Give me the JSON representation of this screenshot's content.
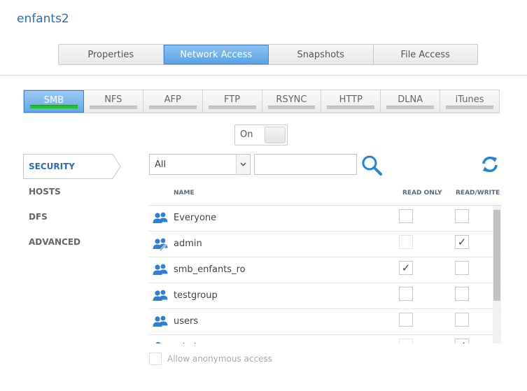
{
  "share": {
    "title": "enfants2"
  },
  "main_tabs": [
    {
      "label": "Properties",
      "active": false
    },
    {
      "label": "Network Access",
      "active": true
    },
    {
      "label": "Snapshots",
      "active": false
    },
    {
      "label": "File Access",
      "active": false
    }
  ],
  "protocol_tabs": [
    {
      "label": "SMB",
      "active": true
    },
    {
      "label": "NFS",
      "active": false
    },
    {
      "label": "AFP",
      "active": false
    },
    {
      "label": "FTP",
      "active": false
    },
    {
      "label": "RSYNC",
      "active": false
    },
    {
      "label": "HTTP",
      "active": false
    },
    {
      "label": "DLNA",
      "active": false
    },
    {
      "label": "iTunes",
      "active": false
    }
  ],
  "toggle": {
    "label": "On"
  },
  "side_nav": [
    {
      "label": "SECURITY",
      "active": true
    },
    {
      "label": "HOSTS",
      "active": false
    },
    {
      "label": "DFS",
      "active": false
    },
    {
      "label": "ADVANCED",
      "active": false
    }
  ],
  "filter": {
    "selected": "All",
    "search_value": ""
  },
  "table": {
    "headers": {
      "name": "NAME",
      "read_only": "READ ONLY",
      "read_write": "READ/WRITE"
    },
    "rows": [
      {
        "name": "Everyone",
        "icon": "group-icon",
        "read_only": false,
        "read_write": false,
        "ro_disabled": false
      },
      {
        "name": "admin",
        "icon": "admin-group-icon",
        "read_only": false,
        "read_write": true,
        "ro_disabled": true
      },
      {
        "name": "smb_enfants_ro",
        "icon": "group-icon",
        "read_only": true,
        "read_write": false,
        "ro_disabled": false
      },
      {
        "name": "testgroup",
        "icon": "group-icon",
        "read_only": false,
        "read_write": false,
        "ro_disabled": false
      },
      {
        "name": "users",
        "icon": "group-icon",
        "read_only": false,
        "read_write": false,
        "ro_disabled": false
      },
      {
        "name": "admin",
        "icon": "user-icon",
        "read_only": false,
        "read_write": true,
        "ro_disabled": true
      }
    ]
  },
  "anonymous": {
    "label": "Allow anonymous access",
    "checked": false
  },
  "colors": {
    "accent": "#2a6ebb",
    "active_tab": "#5aa3e6",
    "active_bar": "#22c02a"
  }
}
